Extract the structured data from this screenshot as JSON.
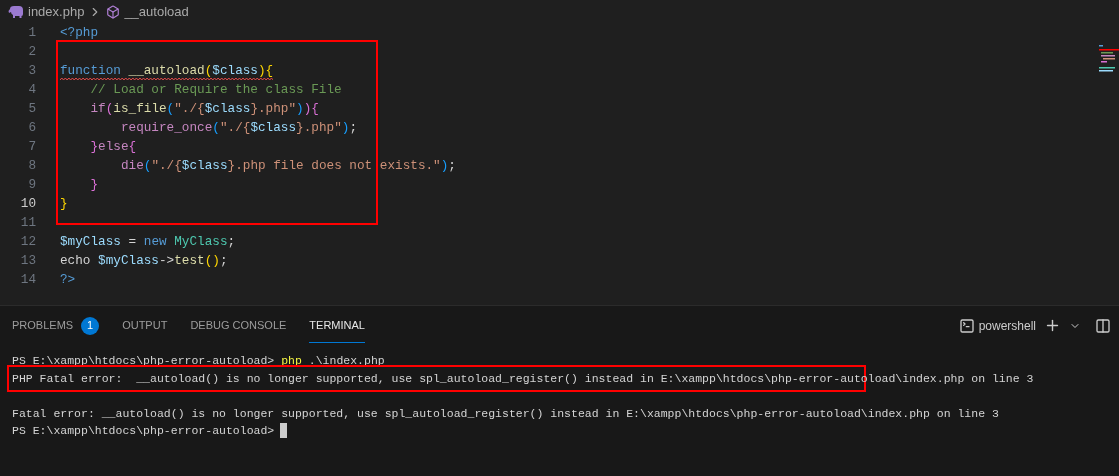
{
  "breadcrumb": [
    {
      "label": "index.php",
      "kind": "file"
    },
    {
      "label": "__autoload",
      "kind": "symbol"
    }
  ],
  "editor": {
    "sections": [
      {
        "boxed": false,
        "lines": [
          {
            "number": "1",
            "current": false,
            "tokens": [
              {
                "text": "<?php",
                "kind": "tag"
              }
            ]
          }
        ]
      },
      {
        "boxed": true,
        "lines": [
          {
            "number": "2",
            "current": false
          },
          {
            "number": "3",
            "current": false,
            "squiggle": true,
            "tokens": [
              {
                "text": "function ",
                "kind": "keyword"
              },
              {
                "text": "__autoload",
                "kind": "function"
              },
              {
                "text": "(",
                "kind": "bracket1"
              },
              {
                "text": "$class",
                "kind": "variable"
              },
              {
                "text": "){",
                "kind": "bracket1"
              }
            ]
          },
          {
            "number": "4",
            "current": false,
            "tokens": [
              {
                "text": "    // Load or Require the class File",
                "kind": "comment"
              }
            ]
          },
          {
            "number": "5",
            "current": false,
            "tokens": [
              {
                "text": "    if",
                "kind": "control"
              },
              {
                "text": "(",
                "kind": "bracket2"
              },
              {
                "text": "is_file",
                "kind": "function"
              },
              {
                "text": "(",
                "kind": "bracket3"
              },
              {
                "text": "\"./{",
                "kind": "string"
              },
              {
                "text": "$class",
                "kind": "variable"
              },
              {
                "text": "}.php\"",
                "kind": "string"
              },
              {
                "text": ")",
                "kind": "bracket3"
              },
              {
                "text": "){",
                "kind": "bracket2"
              }
            ]
          },
          {
            "number": "6",
            "current": false,
            "tokens": [
              {
                "text": "        require_once",
                "kind": "control"
              },
              {
                "text": "(",
                "kind": "bracket3"
              },
              {
                "text": "\"./{",
                "kind": "string"
              },
              {
                "text": "$class",
                "kind": "variable"
              },
              {
                "text": "}.php\"",
                "kind": "string"
              },
              {
                "text": ")",
                "kind": "bracket3"
              },
              {
                "text": ";",
                "kind": "plain"
              }
            ]
          },
          {
            "number": "7",
            "current": false,
            "tokens": [
              {
                "text": "    }",
                "kind": "bracket2"
              },
              {
                "text": "else",
                "kind": "control"
              },
              {
                "text": "{",
                "kind": "bracket2"
              }
            ]
          },
          {
            "number": "8",
            "current": false,
            "tokens": [
              {
                "text": "        die",
                "kind": "control"
              },
              {
                "text": "(",
                "kind": "bracket3"
              },
              {
                "text": "\"./{",
                "kind": "string"
              },
              {
                "text": "$class",
                "kind": "variable"
              },
              {
                "text": "}.php file does not exists.\"",
                "kind": "string"
              },
              {
                "text": ")",
                "kind": "bracket3"
              },
              {
                "text": ";",
                "kind": "plain"
              }
            ]
          },
          {
            "number": "9",
            "current": false,
            "tokens": [
              {
                "text": "    }",
                "kind": "bracket2"
              }
            ]
          },
          {
            "number": "10",
            "current": true,
            "tokens": [
              {
                "text": "}",
                "kind": "bracket1"
              }
            ]
          }
        ]
      },
      {
        "boxed": false,
        "lines": [
          {
            "number": "11",
            "current": false
          },
          {
            "number": "12",
            "current": false,
            "tokens": [
              {
                "text": "$myClass",
                "kind": "variable"
              },
              {
                "text": " = ",
                "kind": "plain"
              },
              {
                "text": "new ",
                "kind": "keyword"
              },
              {
                "text": "MyClass",
                "kind": "class"
              },
              {
                "text": ";",
                "kind": "plain"
              }
            ]
          },
          {
            "number": "13",
            "current": false,
            "tokens": [
              {
                "text": "echo ",
                "kind": "plain"
              },
              {
                "text": "$myClass",
                "kind": "variable"
              },
              {
                "text": "->",
                "kind": "plain"
              },
              {
                "text": "test",
                "kind": "function"
              },
              {
                "text": "()",
                "kind": "bracket1"
              },
              {
                "text": ";",
                "kind": "plain"
              }
            ]
          },
          {
            "number": "14",
            "current": false,
            "tokens": [
              {
                "text": "?>",
                "kind": "tag"
              }
            ]
          }
        ]
      }
    ]
  },
  "panel": {
    "tabs": [
      {
        "label": "PROBLEMS",
        "selected": false,
        "badge": "1"
      },
      {
        "label": "OUTPUT",
        "selected": false
      },
      {
        "label": "DEBUG CONSOLE",
        "selected": false
      },
      {
        "label": "TERMINAL",
        "selected": true
      }
    ],
    "terminal_name": "powershell",
    "terminal": {
      "lines": [
        {
          "boxed": false,
          "tokens": [
            {
              "text": "PS E:\\xampp\\htdocs\\php-error-autoload> ",
              "kind": "plain"
            },
            {
              "text": "php",
              "kind": "command"
            },
            {
              "text": " .\\index.php",
              "kind": "plain"
            }
          ]
        },
        {
          "boxed": true,
          "tokens": [
            {
              "text": "PHP Fatal error:  __autoload() is no longer supported, use spl_autoload_register() instead in E:\\xampp\\htdocs\\php-error-autoload\\index.php on line 3",
              "kind": "plain"
            }
          ]
        },
        {
          "boxed": false
        },
        {
          "boxed": false,
          "tokens": [
            {
              "text": "Fatal error: __autoload() is no longer supported, use spl_autoload_register() instead in E:\\xampp\\htdocs\\php-error-autoload\\index.php on line 3",
              "kind": "plain"
            }
          ]
        },
        {
          "boxed": false,
          "tokens": [
            {
              "text": "PS E:\\xampp\\htdocs\\php-error-autoload>",
              "kind": "plain"
            }
          ]
        }
      ]
    }
  }
}
